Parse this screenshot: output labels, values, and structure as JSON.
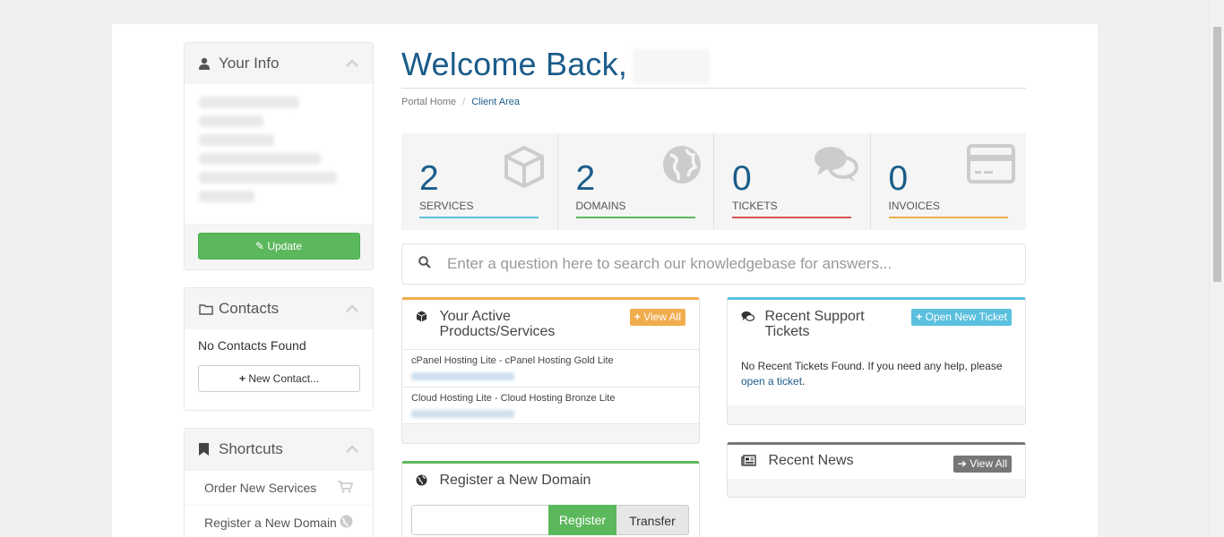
{
  "sidebar": {
    "your_info": {
      "title": "Your Info",
      "update_label": "Update"
    },
    "contacts": {
      "title": "Contacts",
      "empty_text": "No Contacts Found",
      "new_contact_label": "New Contact..."
    },
    "shortcuts": {
      "title": "Shortcuts",
      "items": [
        {
          "label": "Order New Services",
          "icon": "cart-icon"
        },
        {
          "label": "Register a New Domain",
          "icon": "globe-icon"
        }
      ]
    }
  },
  "header": {
    "welcome": "Welcome Back,",
    "breadcrumb": {
      "home": "Portal Home",
      "separator": "/",
      "current": "Client Area"
    }
  },
  "stats": [
    {
      "value": "2",
      "label": "SERVICES",
      "color": "#5bc0de",
      "icon": "cube-icon"
    },
    {
      "value": "2",
      "label": "DOMAINS",
      "color": "#5cb85c",
      "icon": "globe-icon"
    },
    {
      "value": "0",
      "label": "TICKETS",
      "color": "#d9534f",
      "icon": "comments-icon"
    },
    {
      "value": "0",
      "label": "INVOICES",
      "color": "#f0ad4e",
      "icon": "credit-card-icon"
    }
  ],
  "search": {
    "placeholder": "Enter a question here to search our knowledgebase for answers..."
  },
  "products": {
    "title": "Your Active Products/Services",
    "view_all": "View All",
    "items": [
      {
        "name": "cPanel Hosting Lite - cPanel Hosting Gold Lite"
      },
      {
        "name": "Cloud Hosting Lite - Cloud Hosting Bronze Lite"
      }
    ]
  },
  "domain": {
    "title": "Register a New Domain",
    "register_label": "Register",
    "transfer_label": "Transfer"
  },
  "tickets": {
    "title": "Recent Support Tickets",
    "open_new": "Open New Ticket",
    "empty_text": "No Recent Tickets Found. If you need any help, please",
    "link": "open a ticket",
    "after_link": "."
  },
  "news": {
    "title": "Recent News",
    "view_all": "View All"
  },
  "colors": {
    "accent_blue": "#1b5c8a",
    "green": "#5cb85c",
    "orange": "#f0ad4e",
    "info": "#5bc0de",
    "grey": "#777"
  }
}
